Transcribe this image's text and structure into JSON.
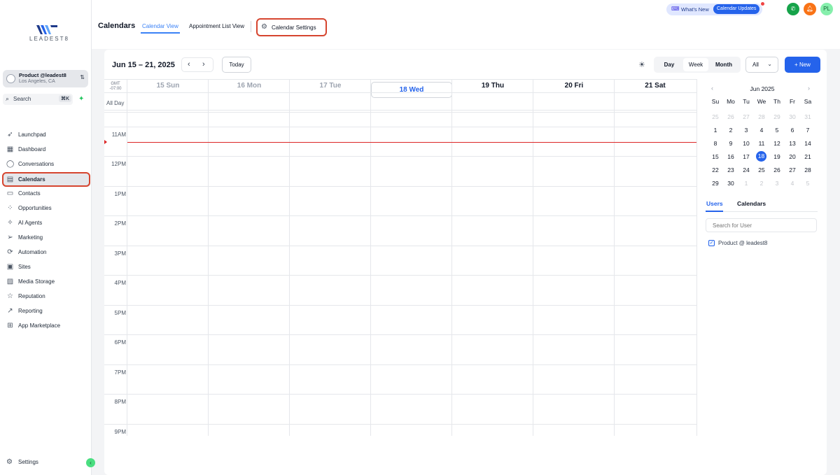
{
  "sidebar": {
    "logo_text": "LEADEST8",
    "account": {
      "name": "Product @leadest8",
      "location": "Los Angeles, CA"
    },
    "search": {
      "label": "Search",
      "shortcut": "⌘K"
    },
    "items": [
      {
        "label": "Launchpad",
        "icon": "rocket-icon"
      },
      {
        "label": "Dashboard",
        "icon": "grid-icon"
      },
      {
        "label": "Conversations",
        "icon": "chat-icon"
      },
      {
        "label": "Calendars",
        "icon": "calendar-icon"
      },
      {
        "label": "Contacts",
        "icon": "contacts-icon"
      },
      {
        "label": "Opportunities",
        "icon": "opportunities-icon"
      },
      {
        "label": "AI Agents",
        "icon": "sparkle-icon"
      },
      {
        "label": "Marketing",
        "icon": "send-icon"
      },
      {
        "label": "Automation",
        "icon": "automation-icon"
      },
      {
        "label": "Sites",
        "icon": "sites-icon"
      },
      {
        "label": "Media Storage",
        "icon": "image-icon"
      },
      {
        "label": "Reputation",
        "icon": "star-icon"
      },
      {
        "label": "Reporting",
        "icon": "trend-icon"
      },
      {
        "label": "App Marketplace",
        "icon": "apps-icon"
      }
    ],
    "settings_label": "Settings"
  },
  "header": {
    "title": "Calendars",
    "tabs": [
      {
        "label": "Calendar View",
        "active": true
      },
      {
        "label": "Appointment List View",
        "active": false
      }
    ],
    "settings_tab": "Calendar Settings",
    "whats_new": "What's New",
    "updates_badge": "Calendar Updates",
    "avatar_initials": "PL",
    "colors": {
      "accent": "#2563eb",
      "phone": "#16a34a",
      "bell": "#f97316",
      "avatar": "#86efac",
      "highlight": "#d6452f"
    }
  },
  "toolbar": {
    "date_range": "Jun 15 – 21, 2025",
    "prev": "‹",
    "next": "›",
    "today": "Today",
    "views": [
      "Day",
      "Week",
      "Month"
    ],
    "filter_value": "All",
    "new_label": "+ New"
  },
  "calendar": {
    "timezone": "GMT -07:00",
    "all_day_label": "All Day",
    "days": [
      {
        "label": "15 Sun",
        "state": "past"
      },
      {
        "label": "16 Mon",
        "state": "past"
      },
      {
        "label": "17 Tue",
        "state": "past"
      },
      {
        "label": "18 Wed",
        "state": "today"
      },
      {
        "label": "19 Thu",
        "state": "future"
      },
      {
        "label": "20 Fri",
        "state": "future"
      },
      {
        "label": "21 Sat",
        "state": "future"
      }
    ],
    "hours": [
      "11AM",
      "12PM",
      "1PM",
      "2PM",
      "3PM",
      "4PM",
      "5PM",
      "6PM",
      "7PM",
      "8PM",
      "9PM"
    ]
  },
  "mini_calendar": {
    "month": "Jun 2025",
    "weekdays": [
      "Su",
      "Mo",
      "Tu",
      "We",
      "Th",
      "Fr",
      "Sa"
    ],
    "weeks": [
      [
        "25",
        "26",
        "27",
        "28",
        "29",
        "30",
        "31"
      ],
      [
        "1",
        "2",
        "3",
        "4",
        "5",
        "6",
        "7"
      ],
      [
        "8",
        "9",
        "10",
        "11",
        "12",
        "13",
        "14"
      ],
      [
        "15",
        "16",
        "17",
        "18",
        "19",
        "20",
        "21"
      ],
      [
        "22",
        "23",
        "24",
        "25",
        "26",
        "27",
        "28"
      ],
      [
        "29",
        "30",
        "1",
        "2",
        "3",
        "4",
        "5"
      ]
    ],
    "selected": "18"
  },
  "users_panel": {
    "tabs": [
      "Users",
      "Calendars"
    ],
    "search_placeholder": "Search for User",
    "users": [
      {
        "label": "Product @ leadest8",
        "checked": true
      }
    ]
  }
}
